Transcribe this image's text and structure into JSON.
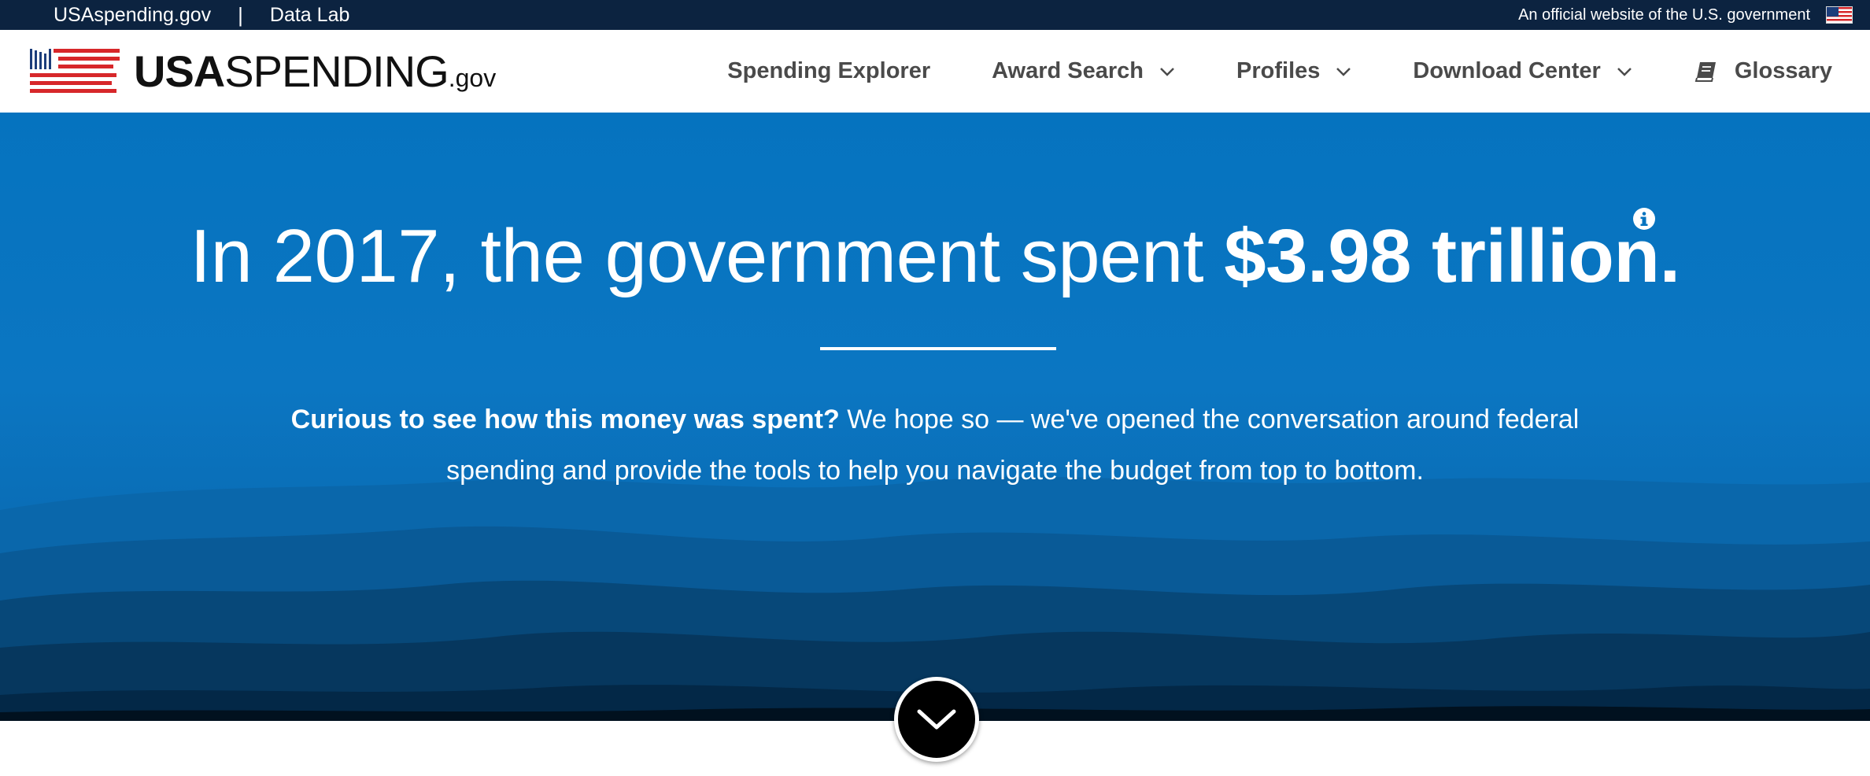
{
  "topbar": {
    "site_link": "USAspending.gov",
    "separator": "|",
    "datalab_link": "Data Lab",
    "official_text": "An official website of the U.S. government"
  },
  "logo": {
    "usa": "USA",
    "spending": "SPENDING",
    "gov": ".gov"
  },
  "nav": {
    "spending_explorer": "Spending Explorer",
    "award_search": "Award Search",
    "profiles": "Profiles",
    "download_center": "Download Center",
    "glossary": "Glossary"
  },
  "hero": {
    "headline_prefix": "In 2017, the government spent ",
    "headline_amount": "$3.98 trillion.",
    "intro_bold": "Curious to see how this money was spent?",
    "intro_rest": " We hope so — we've opened the conversation around federal spending and provide the tools to help you navigate the budget from top to bottom."
  },
  "icons": {
    "info": "info-icon",
    "scroll": "chevron-down-icon",
    "glossary": "book-icon",
    "flag": "us-flag-icon"
  },
  "colors": {
    "topbar": "#0c2340",
    "hero_blue": "#0573bf",
    "nav_text": "#4a4a4a",
    "flag_red": "#d7272a",
    "flag_navy": "#1c3d7a"
  }
}
